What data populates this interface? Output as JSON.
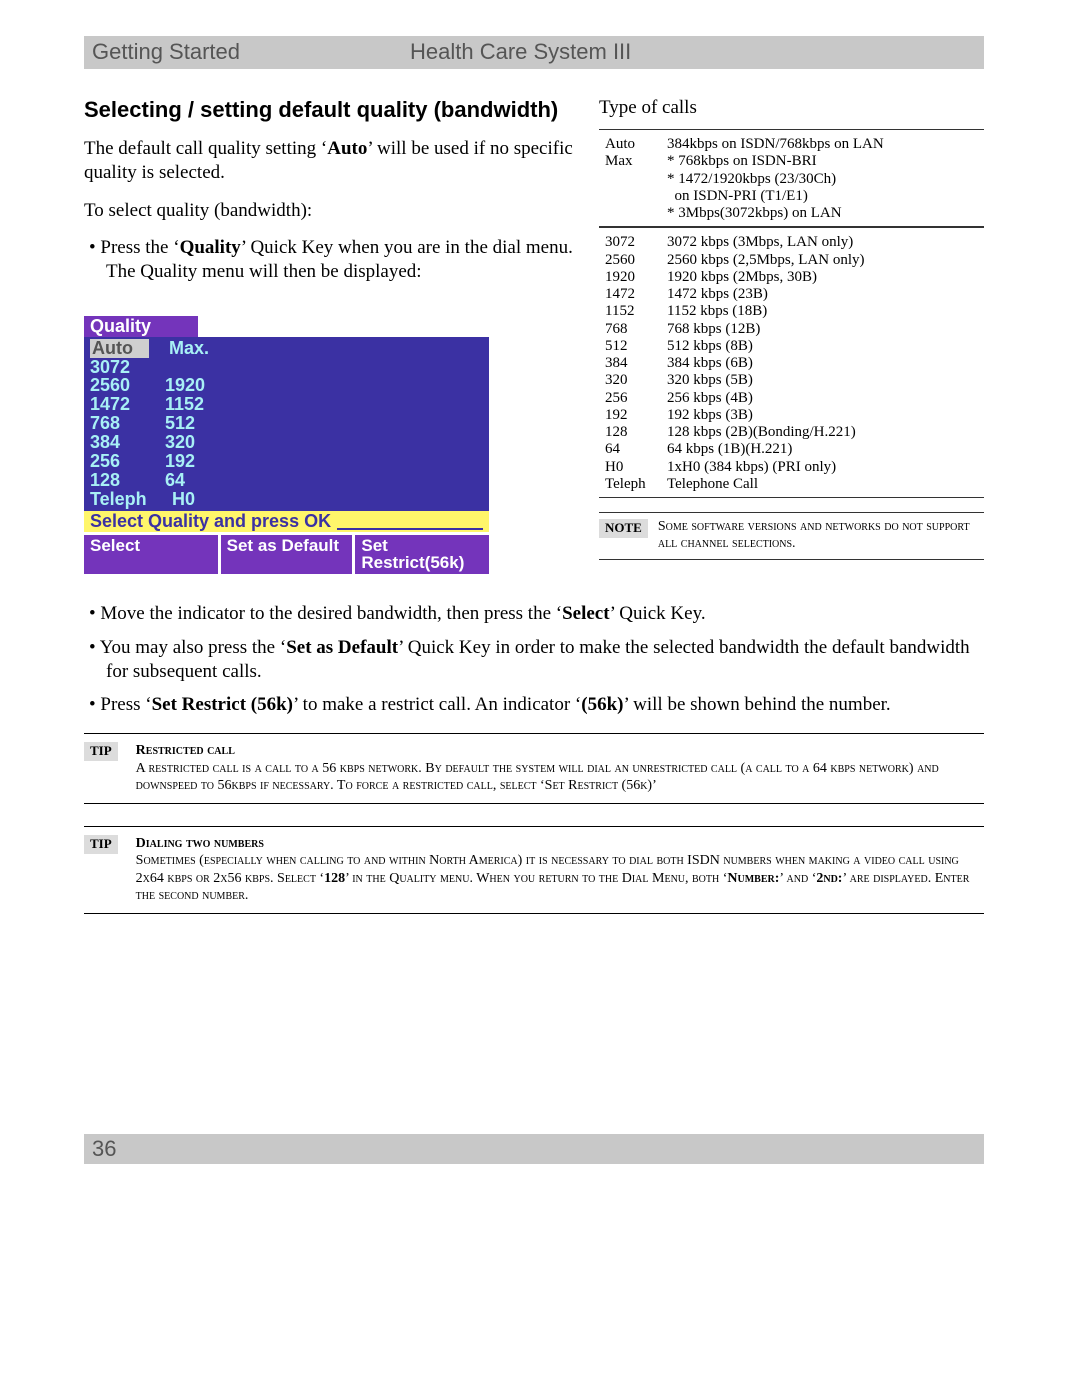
{
  "header": {
    "left": "Getting Started",
    "right": "Health Care System III"
  },
  "section_title": "Selecting / setting default quality (bandwidth)",
  "intro1_a": "The default call quality setting ‘",
  "intro1_bold": "Auto",
  "intro1_b": "’ will be used if no specific quality is selected.",
  "intro2": "To select quality (bandwidth):",
  "bullet1_a": "Press the ‘",
  "bullet1_bold": "Quality",
  "bullet1_b": "’ Quick Key when you are in the dial menu. The Quality menu will then be displayed:",
  "quality_menu": {
    "title": "Quality",
    "rows": [
      [
        "Auto",
        "Max."
      ],
      [
        "3072",
        ""
      ],
      [
        "2560",
        "1920"
      ],
      [
        "1472",
        "1152"
      ],
      [
        "768",
        "512"
      ],
      [
        "384",
        "320"
      ],
      [
        "256",
        "192"
      ],
      [
        "128",
        "64"
      ],
      [
        "Teleph",
        "H0"
      ]
    ],
    "hint": "Select Quality and press OK",
    "qk1": "Select",
    "qk2": "Set as Default",
    "qk3": "Set Restrict(56k)"
  },
  "type_heading": "Type of calls",
  "type_top": {
    "Auto": "384kbps on ISDN/768kbps on LAN",
    "Max_lines": [
      "* 768kbps on ISDN-BRI",
      "* 1472/1920kbps (23/30Ch)",
      "  on ISDN-PRI (T1/E1)",
      "* 3Mbps(3072kbps)  on LAN"
    ]
  },
  "type_rows": [
    [
      "3072",
      "3072 kbps (3Mbps, LAN only)"
    ],
    [
      "2560",
      "2560 kbps (2,5Mbps, LAN only)"
    ],
    [
      "1920",
      "1920 kbps (2Mbps, 30B)"
    ],
    [
      "1472",
      "1472 kbps (23B)"
    ],
    [
      "1152",
      "1152 kbps (18B)"
    ],
    [
      "768",
      "768 kbps (12B)"
    ],
    [
      "512",
      "512 kbps (8B)"
    ],
    [
      "384",
      "384 kbps (6B)"
    ],
    [
      "320",
      "320 kbps (5B)"
    ],
    [
      "256",
      "256 kbps (4B)"
    ],
    [
      "192",
      "192 kbps (3B)"
    ],
    [
      "128",
      "128 kbps (2B)(Bonding/H.221)"
    ],
    [
      "64",
      "64 kbps (1B)(H.221)"
    ],
    [
      "H0",
      "1xH0 (384 kbps) (PRI only)"
    ],
    [
      "Teleph",
      "Telephone Call"
    ]
  ],
  "note_badge": "NOTE",
  "note_text": "Some software versions and networks do not support all channel selections.",
  "lower_b1_a": "Move the indicator to the desired bandwidth, then press the ‘",
  "lower_b1_bold": "Select",
  "lower_b1_b": "’ Quick Key.",
  "lower_b2_a": "You may also press the ‘",
  "lower_b2_bold": "Set as Default",
  "lower_b2_b": "’ Quick Key in order to make the selected bandwidth the default bandwidth for subsequent calls.",
  "lower_b3_a": "Press ‘",
  "lower_b3_bold": "Set Restrict (56k)",
  "lower_b3_b": "’ to make a restrict call. An indicator ‘",
  "lower_b3_bold2": "(56k)",
  "lower_b3_c": "’ will be shown behind the number.",
  "tip_badge": "TIP",
  "tip1": {
    "title": "Restricted call",
    "body": "A restricted call is a call to a 56 kbps network. By default the system will dial an unrestricted call (a call to a 64 kbps network) and downspeed to 56kbps if necessary. To force a restricted call, select ‘Set Restrict (56k)’"
  },
  "tip2": {
    "title": "Dialing two numbers",
    "body_a": "Sometimes (especially when calling to and within North America) it is necessary to dial both ISDN numbers when making a video call using 2x64 kbps or 2x56 kbps. Select ‘",
    "body_bold1": "128",
    "body_b": "’ in the Quality menu. When you return to the Dial Menu, both ‘",
    "body_bold2": "Number:",
    "body_c": "’ and ‘",
    "body_bold3": "2nd:",
    "body_d": "’ are displayed. Enter the second number."
  },
  "page_number": "36"
}
